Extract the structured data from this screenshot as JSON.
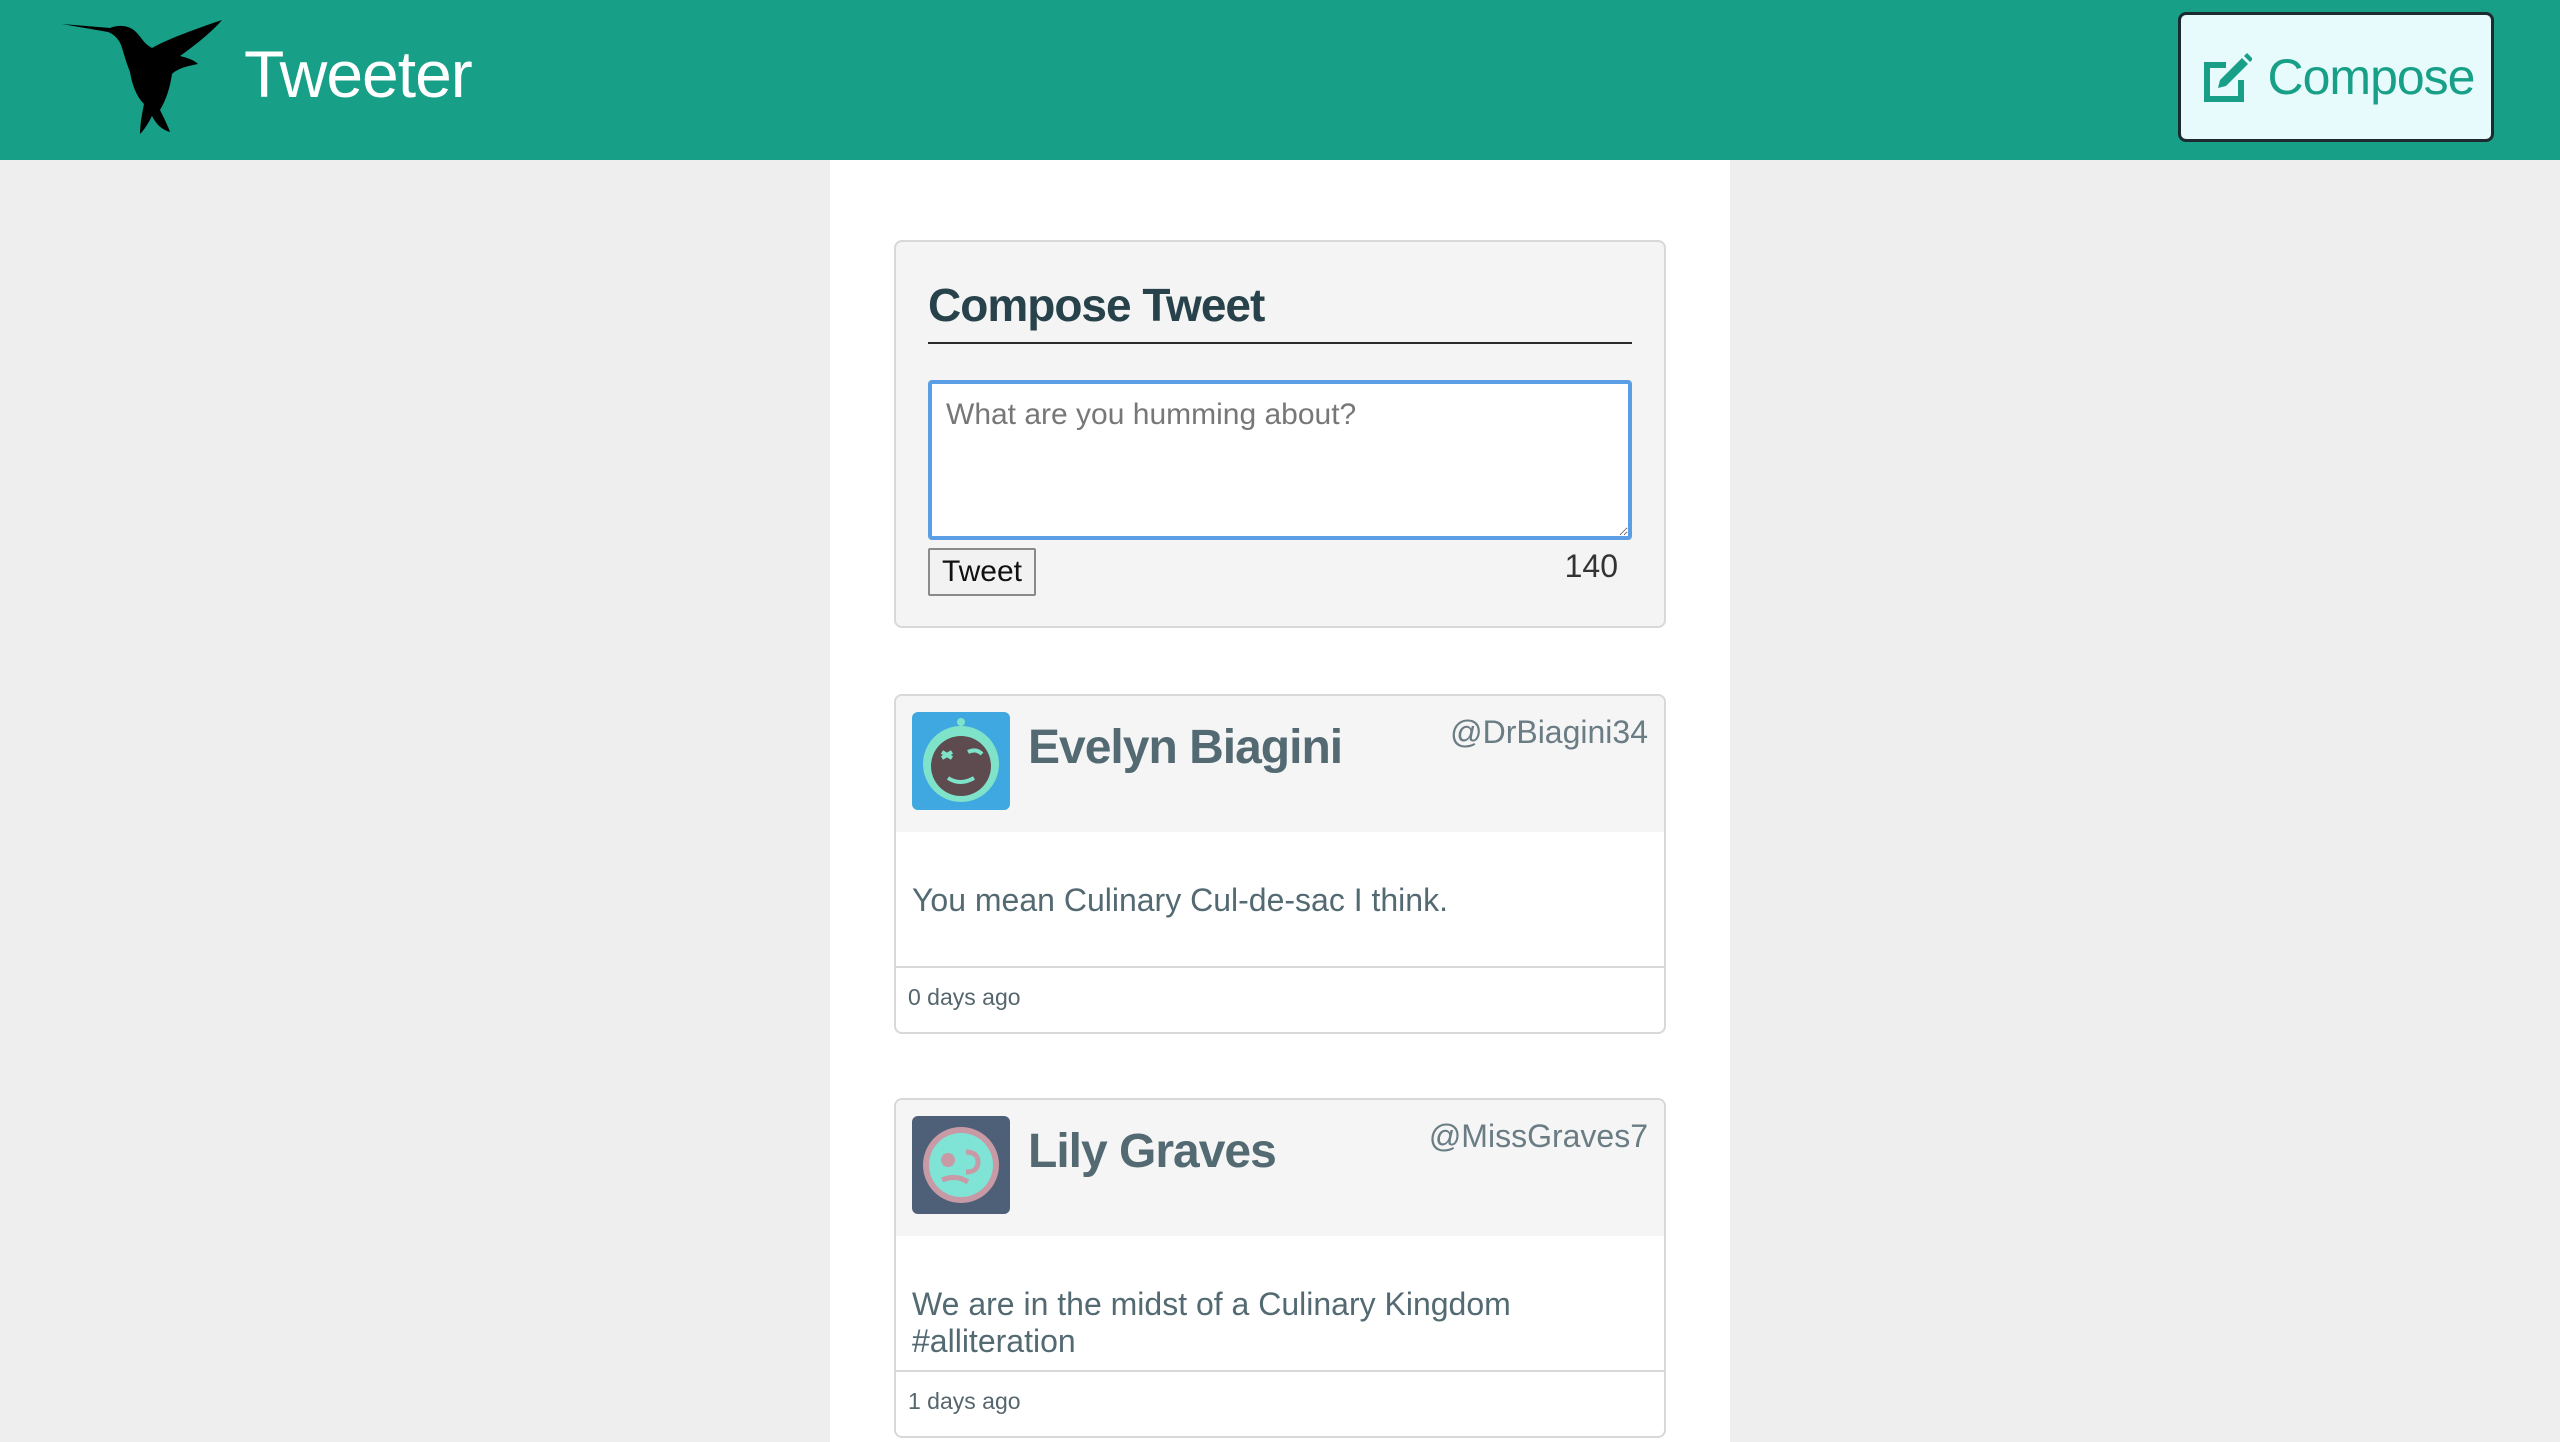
{
  "header": {
    "brand": "Tweeter",
    "compose_button": {
      "label": "Compose",
      "icon": "edit-icon"
    },
    "colors": {
      "bar": "#17a087",
      "button_bg": "#e8fbfc",
      "button_text": "#17a087"
    }
  },
  "compose": {
    "title": "Compose Tweet",
    "placeholder": "What are you humming about?",
    "value": "",
    "submit_label": "Tweet",
    "char_counter": "140"
  },
  "tweets": [
    {
      "name": "Evelyn Biagini",
      "handle": "@DrBiagini34",
      "text": "You mean Culinary Cul-de-sac I think.",
      "time": "0 days ago",
      "avatar": "robot-avatar-icon"
    },
    {
      "name": "Lily Graves",
      "handle": "@MissGraves7",
      "text": "We are in the midst of a Culinary Kingdom #alliteration",
      "time": "1 days ago",
      "avatar": "robot-avatar-icon"
    }
  ]
}
